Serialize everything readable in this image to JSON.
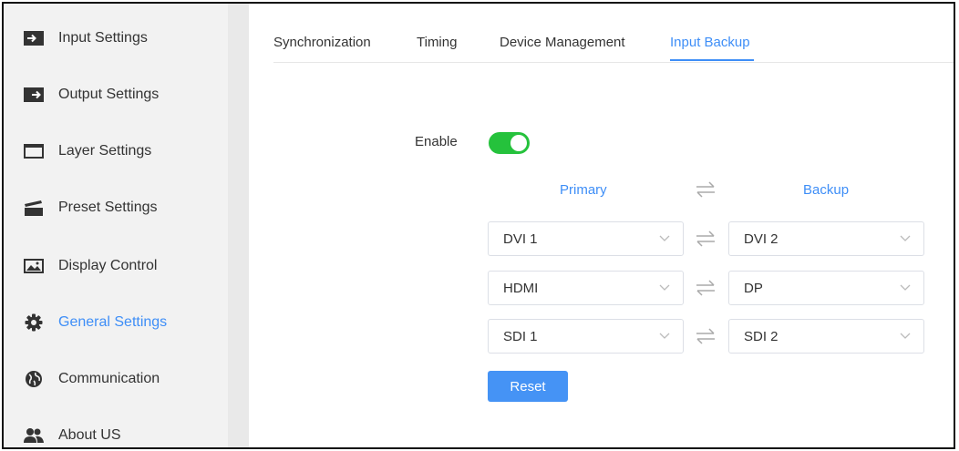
{
  "sidebar": {
    "items": [
      {
        "label": "Input Settings",
        "icon": "input-icon"
      },
      {
        "label": "Output Settings",
        "icon": "output-icon"
      },
      {
        "label": "Layer Settings",
        "icon": "window-icon"
      },
      {
        "label": "Preset Settings",
        "icon": "clapperboard-icon"
      },
      {
        "label": "Display Control",
        "icon": "image-icon"
      },
      {
        "label": "General Settings",
        "icon": "gear-icon",
        "active": true
      },
      {
        "label": "Communication",
        "icon": "globe-icon"
      },
      {
        "label": "About US",
        "icon": "users-icon"
      }
    ]
  },
  "tabs": [
    {
      "label": "Synchronization"
    },
    {
      "label": "Timing"
    },
    {
      "label": "Device Management"
    },
    {
      "label": "Input Backup",
      "active": true
    }
  ],
  "backup": {
    "enable_label": "Enable",
    "enabled": true,
    "primary_header": "Primary",
    "backup_header": "Backup",
    "rows": [
      {
        "primary": "DVI 1",
        "backup": "DVI 2"
      },
      {
        "primary": "HDMI",
        "backup": "DP"
      },
      {
        "primary": "SDI 1",
        "backup": "SDI 2"
      }
    ],
    "reset_label": "Reset"
  },
  "colors": {
    "accent": "#3e8ef7",
    "toggle_on": "#25c23c",
    "sidebar_bg": "#f2f2f2"
  }
}
